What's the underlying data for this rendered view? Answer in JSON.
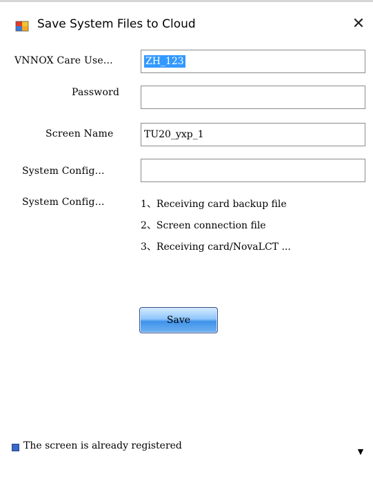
{
  "window": {
    "title": "Save System Files to Cloud",
    "close_glyph": "✕",
    "icon": "app-window-icon"
  },
  "form": {
    "care_user_label": "VNNOX Care Use...",
    "care_user_value": "ZH_123",
    "password_label": "Password",
    "password_value": "",
    "screen_name_label": "Screen Name",
    "screen_name_value": "TU20_yxp_1",
    "system_config_label": "System Config...",
    "system_config_value": "",
    "system_config_files_label": "System Config...",
    "files": [
      "1、Receiving card backup file",
      "2、Screen connection file",
      "3、Receiving card/NovaLCT ..."
    ]
  },
  "actions": {
    "save_label": "Save"
  },
  "status": {
    "text": "The screen is already registered",
    "color": "#3a67c6"
  },
  "colors": {
    "selection": "#3399ff",
    "button_blue": "#3f93ea"
  }
}
